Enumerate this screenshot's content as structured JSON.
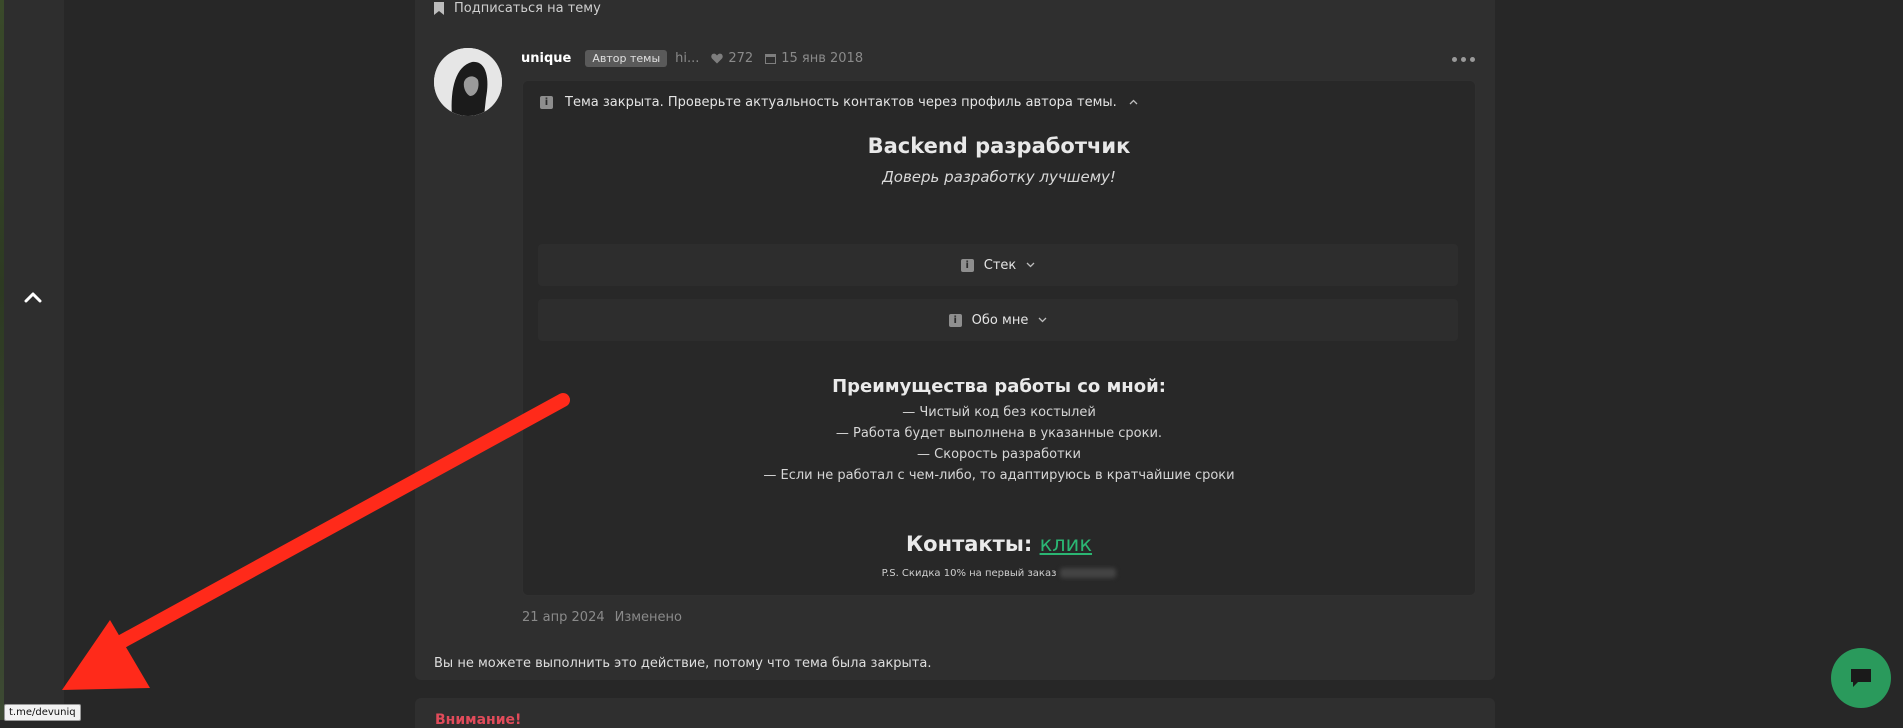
{
  "nav": {
    "subscribe_label": "Подписаться на тему"
  },
  "post": {
    "username": "unique",
    "author_badge": "Автор темы",
    "truncated": "hi...",
    "likes": "272",
    "date": "15 янв 2018",
    "notice": "Тема закрыта. Проверьте актуальность контактов через профиль автора темы.",
    "title": "Backend разработчик",
    "subtitle": "Доверь разработку лучшему!",
    "spoilers": [
      {
        "label": "Стек"
      },
      {
        "label": "Обо мне"
      }
    ],
    "advantages_title": "Преимущества работы со мной:",
    "advantages": [
      "— Чистый код без костылей",
      "— Работа будет выполнена в указанные сроки.",
      "— Скорость разработки",
      "— Если не работал с чем-либо, то адаптируюсь в кратчайшие сроки"
    ],
    "contacts_label": "Контакты",
    "contacts_link": "клик",
    "ps": "P.S. Скидка 10% на первый заказ",
    "edit_date": "21 апр 2024",
    "edited_label": "Изменено"
  },
  "closed_message": "Вы не можете выполнить это действие, потому что тема была закрыта.",
  "next_heading": "Внимание!",
  "tooltip": "t.me/devuniq",
  "colors": {
    "accent_green": "#2bb673",
    "chat_bg": "#2a9a5c",
    "arrow": "#ff2a1a",
    "warning_red": "#e14b5a"
  },
  "icons": [
    "bookmark-icon",
    "heart-icon",
    "calendar-icon",
    "info-icon",
    "chevron-down-icon",
    "chevron-up-icon",
    "more-dots-icon",
    "chat-icon"
  ]
}
